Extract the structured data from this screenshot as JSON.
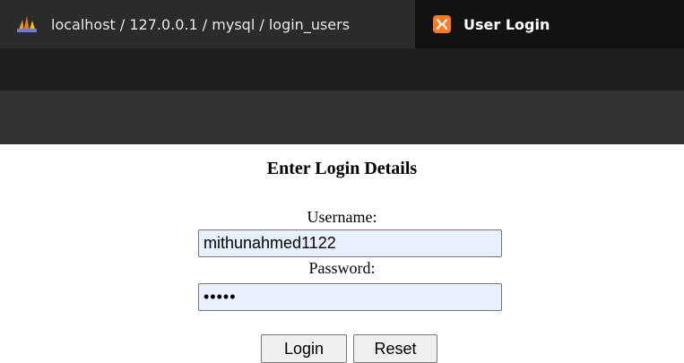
{
  "browser": {
    "tabs": [
      {
        "title": "localhost / 127.0.0.1 / mysql / login_users",
        "icon": "phpmyadmin-icon",
        "active": false
      },
      {
        "title": "User Login",
        "icon": "xampp-icon",
        "active": true
      }
    ]
  },
  "form": {
    "heading": "Enter Login Details",
    "username_label": "Username:",
    "username_value": "mithunahmed1122",
    "password_label": "Password:",
    "password_value": "•••••",
    "login_button": "Login",
    "reset_button": "Reset"
  },
  "colors": {
    "tab_bar": "#121212",
    "inactive_tab": "#2b2b2b",
    "xampp_orange": "#fb7a24",
    "autofill_bg": "#e8f0fe"
  }
}
